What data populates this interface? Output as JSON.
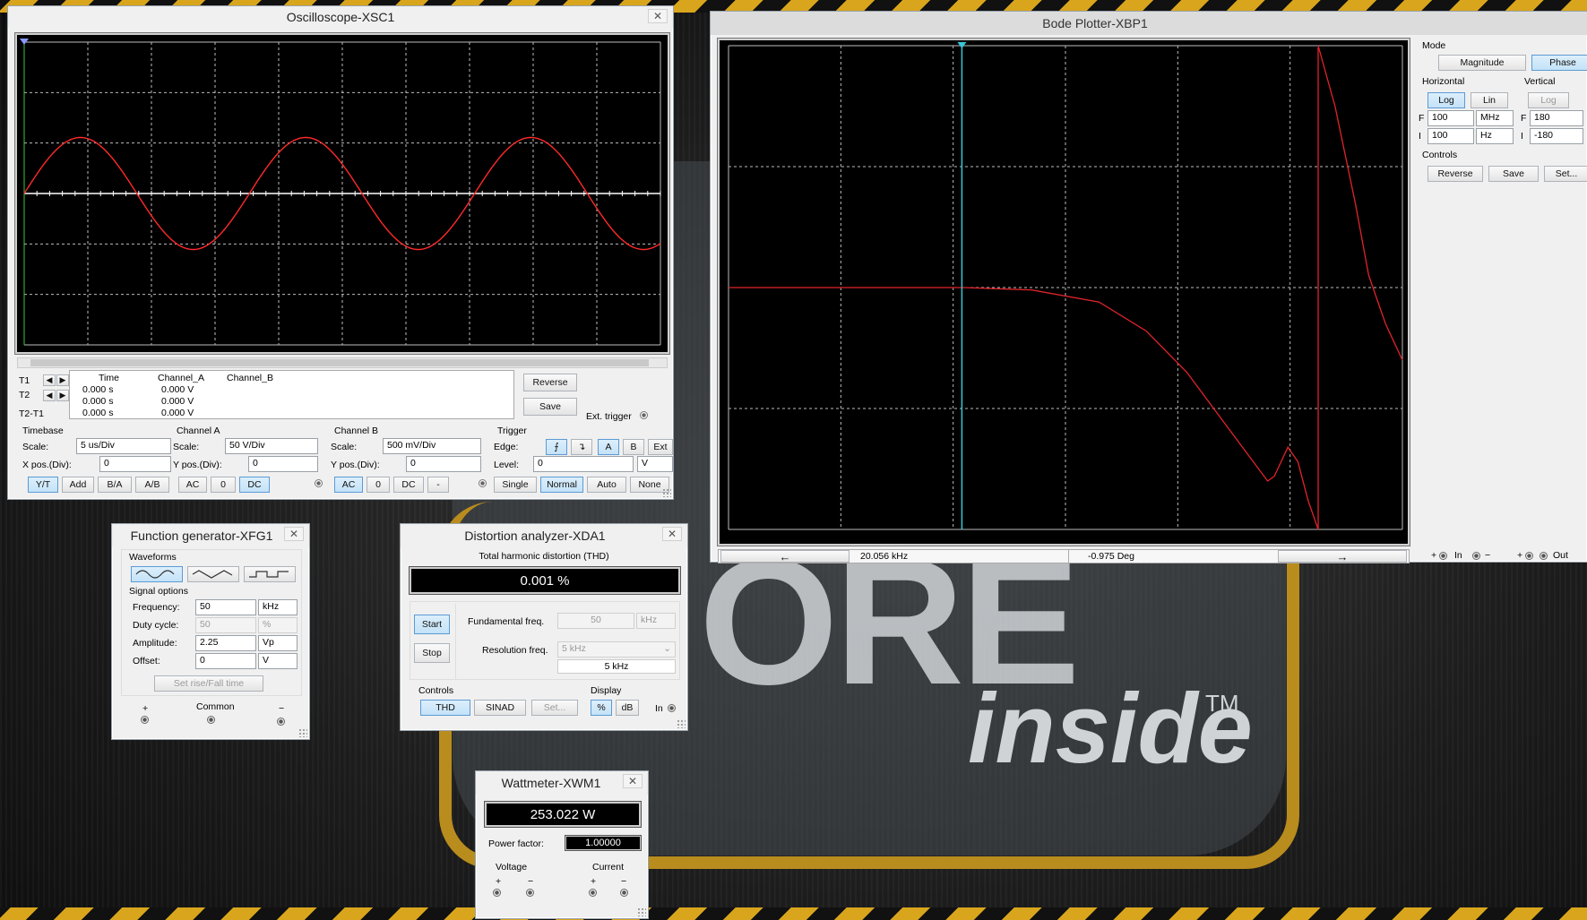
{
  "background": {
    "logo_text_1": "ORE",
    "logo_text_2": "inside",
    "tm": "TM"
  },
  "oscilloscope": {
    "title": "Oscilloscope-XSC1",
    "close": "✕",
    "readout": {
      "headers": [
        "Time",
        "Channel_A",
        "Channel_B"
      ],
      "rows": [
        {
          "label": "T1",
          "time": "0.000 s",
          "a": "0.000 V",
          "b": ""
        },
        {
          "label": "T2",
          "time": "0.000 s",
          "a": "0.000 V",
          "b": ""
        },
        {
          "label": "T2-T1",
          "time": "0.000 s",
          "a": "0.000 V",
          "b": ""
        }
      ]
    },
    "reverse": "Reverse",
    "save": "Save",
    "ext_trigger": "Ext. trigger",
    "timebase": {
      "title": "Timebase",
      "scale_label": "Scale:",
      "scale": "5 us/Div",
      "xpos_label": "X pos.(Div):",
      "xpos": "0",
      "buttons": [
        "Y/T",
        "Add",
        "B/A",
        "A/B"
      ]
    },
    "channel_a": {
      "title": "Channel A",
      "scale_label": "Scale:",
      "scale": "50  V/Div",
      "ypos_label": "Y pos.(Div):",
      "ypos": "0",
      "buttons": [
        "AC",
        "0",
        "DC"
      ]
    },
    "channel_b": {
      "title": "Channel B",
      "scale_label": "Scale:",
      "scale": "500 mV/Div",
      "ypos_label": "Y pos.(Div):",
      "ypos": "0",
      "buttons": [
        "AC",
        "0",
        "DC",
        "-"
      ]
    },
    "trigger": {
      "title": "Trigger",
      "edge_label": "Edge:",
      "edge_buttons": [
        "⨍",
        "↴",
        "A",
        "B",
        "Ext"
      ],
      "level_label": "Level:",
      "level": "0",
      "level_unit": "V",
      "mode_buttons": [
        "Single",
        "Normal",
        "Auto",
        "None"
      ]
    },
    "trace_color": "#ff2a2a"
  },
  "bode": {
    "title": "Bode Plotter-XBP1",
    "mode_title": "Mode",
    "magnitude": "Magnitude",
    "phase": "Phase",
    "horizontal_title": "Horizontal",
    "vertical_title": "Vertical",
    "h_log": "Log",
    "h_lin": "Lin",
    "v_log": "Log",
    "h_f_label": "F",
    "h_f_value": "100",
    "h_f_unit": "MHz",
    "h_i_label": "I",
    "h_i_value": "100",
    "h_i_unit": "Hz",
    "v_f_label": "F",
    "v_f_value": "180",
    "v_i_label": "I",
    "v_i_value": "-180",
    "controls_title": "Controls",
    "reverse": "Reverse",
    "save": "Save",
    "set": "Set...",
    "left_arrow": "←",
    "right_arrow": "→",
    "freq_readout": "20.056 kHz",
    "value_readout": "-0.975 Deg",
    "in_label": "In",
    "out_label": "Out",
    "plus": "+",
    "minus": "−",
    "trace_color": "#e0242a",
    "cursor_color": "#39c6d8"
  },
  "function_generator": {
    "title": "Function generator-XFG1",
    "waveforms_title": "Waveforms",
    "signal_title": "Signal options",
    "waveforms": [
      "sine",
      "triangle",
      "square"
    ],
    "rows": [
      {
        "label": "Frequency:",
        "value": "50",
        "unit": "kHz",
        "enabled": true
      },
      {
        "label": "Duty cycle:",
        "value": "50",
        "unit": "%",
        "enabled": false
      },
      {
        "label": "Amplitude:",
        "value": "2.25",
        "unit": "Vp",
        "enabled": true
      },
      {
        "label": "Offset:",
        "value": "0",
        "unit": "V",
        "enabled": true
      }
    ],
    "rise_fall": "Set rise/Fall time",
    "plus": "+",
    "common": "Common",
    "minus": "−"
  },
  "distortion": {
    "title": "Distortion analyzer-XDA1",
    "thd_title": "Total harmonic distortion (THD)",
    "thd_value": "0.001 %",
    "start": "Start",
    "stop": "Stop",
    "fund_label": "Fundamental freq.",
    "fund_value": "50",
    "fund_unit": "kHz",
    "res_label": "Resolution freq.",
    "res_select": "5 kHz",
    "res_value": "5 kHz",
    "controls_title": "Controls",
    "thd": "THD",
    "sinad": "SINAD",
    "set": "Set...",
    "display_title": "Display",
    "pct": "%",
    "db": "dB",
    "in_label": "In"
  },
  "wattmeter": {
    "title": "Wattmeter-XWM1",
    "power": "253.022 W",
    "pf_label": "Power factor:",
    "pf_value": "1.00000",
    "voltage": "Voltage",
    "current": "Current",
    "plus": "+",
    "minus": "−"
  }
}
